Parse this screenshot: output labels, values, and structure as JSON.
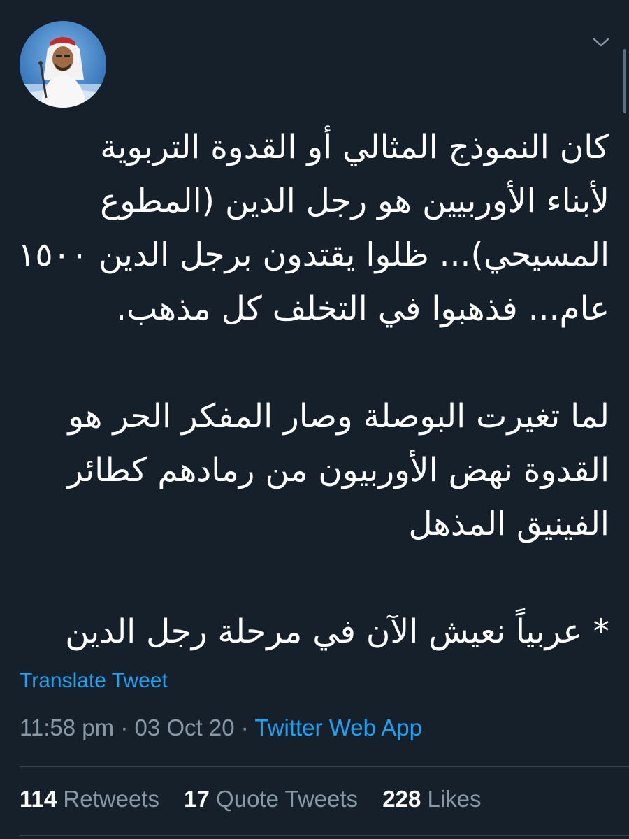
{
  "tweet": {
    "paragraphs": [
      "كان النموذج المثالي أو القدوة التربوية\nلأبناء الأوربيين هو رجل الدين (المطوع\nالمسيحي)... ظلوا يقتدون برجل الدين ١٥٠٠\nعام... فذهبوا في التخلف كل مذهب.",
      "لما تغيرت البوصلة وصار المفكر الحر هو\nالقدوة نهض الأوربيون من رمادهم كطائر\nالفينيق المذهل",
      "* عربياً نعيش الآن في مرحلة رجل الدين"
    ],
    "translate_label": "Translate Tweet",
    "time": "11:58 pm",
    "date": "03 Oct 20",
    "separator": "·",
    "source": "Twitter Web App"
  },
  "stats": {
    "retweets_count": "114",
    "retweets_label": "Retweets",
    "quotes_count": "17",
    "quotes_label": "Quote Tweets",
    "likes_count": "228",
    "likes_label": "Likes"
  },
  "icons": {
    "avatar": "profile-avatar",
    "caret": "chevron-down-icon"
  },
  "colors": {
    "background": "#15202b",
    "text": "#ffffff",
    "muted": "#8899a6",
    "link": "#1da1f2",
    "divider": "#38444d"
  }
}
